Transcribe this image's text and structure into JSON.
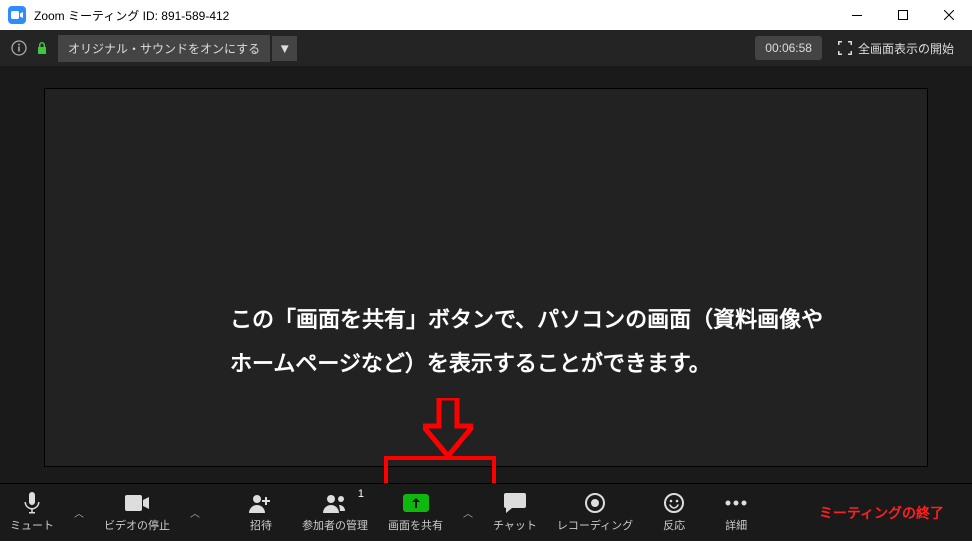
{
  "titlebar": {
    "title": "Zoom ミーティング ID: 891-589-412"
  },
  "topbar": {
    "sound_label": "オリジナル・サウンドをオンにする",
    "timer": "00:06:58",
    "fullscreen_label": "全画面表示の開始"
  },
  "overlay": {
    "text": "この「画面を共有」ボタンで、パソコンの画面（資料画像やホームページなど）を表示することができます。"
  },
  "bottombar": {
    "mute": "ミュート",
    "video": "ビデオの停止",
    "invite": "招待",
    "participants": "参加者の管理",
    "participants_count": "1",
    "share": "画面を共有",
    "chat": "チャット",
    "record": "レコーディング",
    "reactions": "反応",
    "more": "詳細",
    "end": "ミーティングの終了"
  }
}
